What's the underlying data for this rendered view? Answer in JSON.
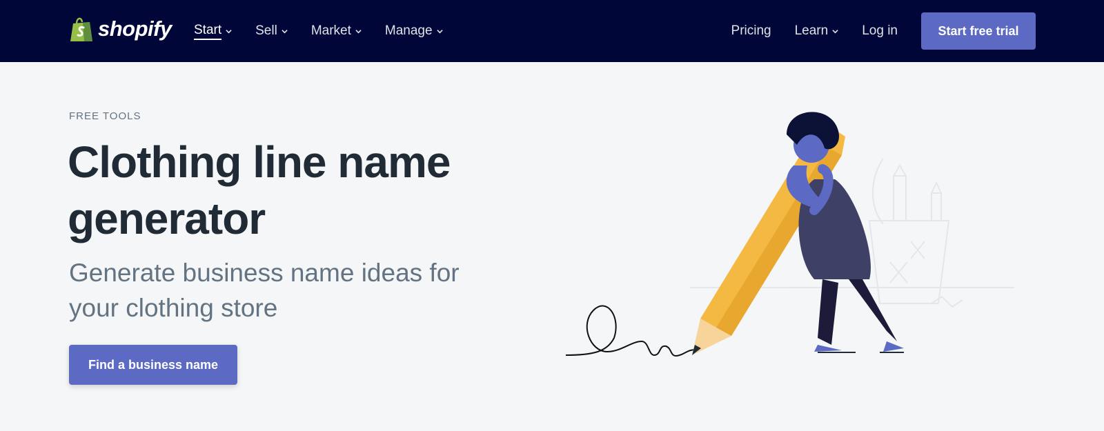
{
  "brand": {
    "name": "shopify"
  },
  "nav": {
    "left": [
      {
        "label": "Start",
        "active": true
      },
      {
        "label": "Sell"
      },
      {
        "label": "Market"
      },
      {
        "label": "Manage"
      }
    ],
    "right": [
      {
        "label": "Pricing"
      },
      {
        "label": "Learn"
      },
      {
        "label": "Log in"
      }
    ],
    "cta_label": "Start free trial"
  },
  "hero": {
    "eyebrow": "FREE TOOLS",
    "title": "Clothing line name generator",
    "subtitle": "Generate business name ideas for your clothing store",
    "cta_label": "Find a business name"
  },
  "colors": {
    "nav_bg": "#000638",
    "accent": "#5c6ac4",
    "page_bg": "#f4f6f8",
    "pencil": "#f4b942"
  }
}
